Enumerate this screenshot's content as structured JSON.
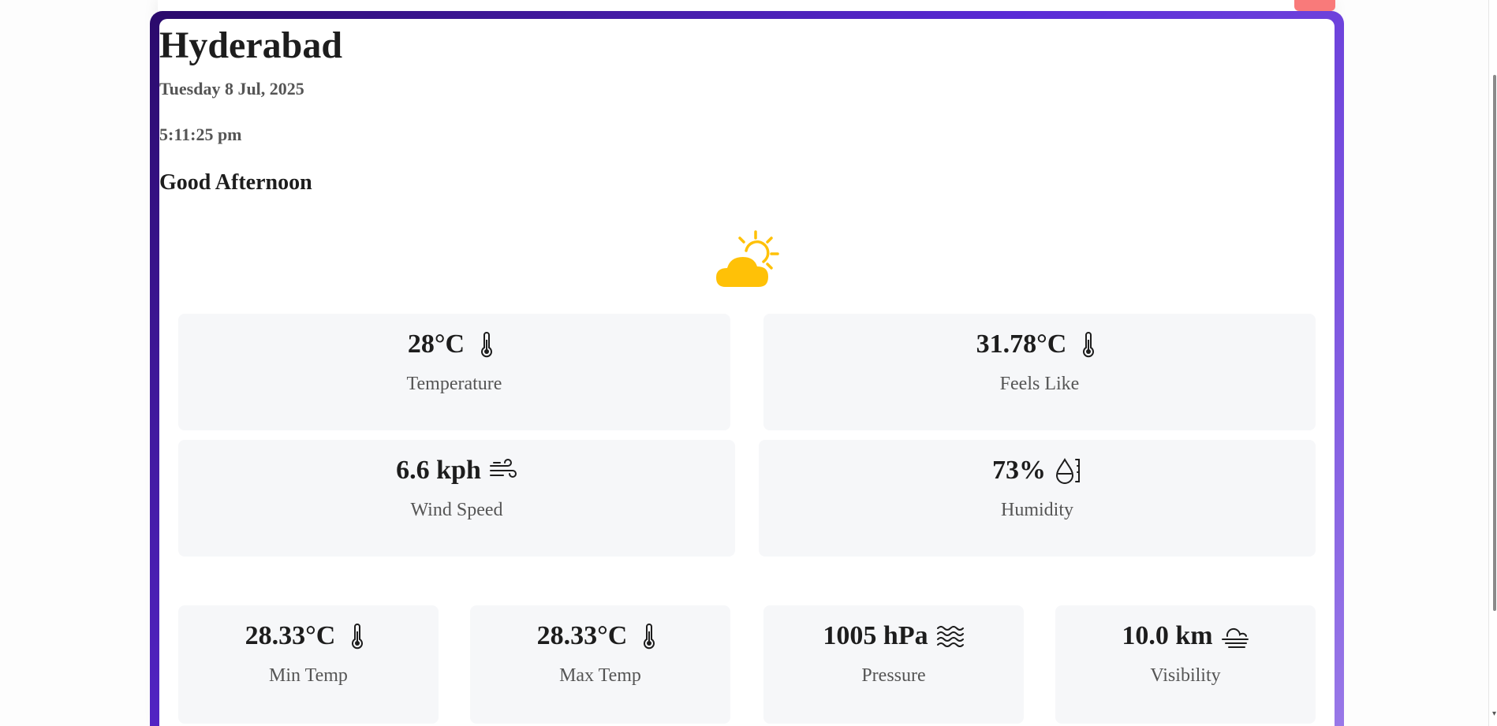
{
  "location": {
    "city": "Hyderabad",
    "date": "Tuesday 8 Jul, 2025",
    "time": "5:11:25 pm",
    "greeting": "Good Afternoon",
    "condition_icon": "partly-cloudy-icon"
  },
  "primary_stats": [
    {
      "value": "28°C",
      "label": "Temperature",
      "icon": "thermometer-icon"
    },
    {
      "value": "31.78°C",
      "label": "Feels Like",
      "icon": "thermometer-icon"
    },
    {
      "value": "6.6 kph",
      "label": "Wind Speed",
      "icon": "wind-icon"
    },
    {
      "value": "73%",
      "label": "Humidity",
      "icon": "humidity-icon"
    }
  ],
  "secondary_stats": [
    {
      "value": "28.33°C",
      "label": "Min Temp",
      "icon": "thermometer-icon"
    },
    {
      "value": "28.33°C",
      "label": "Max Temp",
      "icon": "thermometer-icon"
    },
    {
      "value": "1005 hPa",
      "label": "Pressure",
      "icon": "waves-icon"
    },
    {
      "value": "10.0 km",
      "label": "Visibility",
      "icon": "fog-icon"
    }
  ],
  "colors": {
    "frame_start": "#2a0a6b",
    "frame_mid": "#5a2ad6",
    "frame_end": "#9a7ae8",
    "sun_cloud": "#ffc107",
    "tile_bg": "#f6f7f9"
  }
}
